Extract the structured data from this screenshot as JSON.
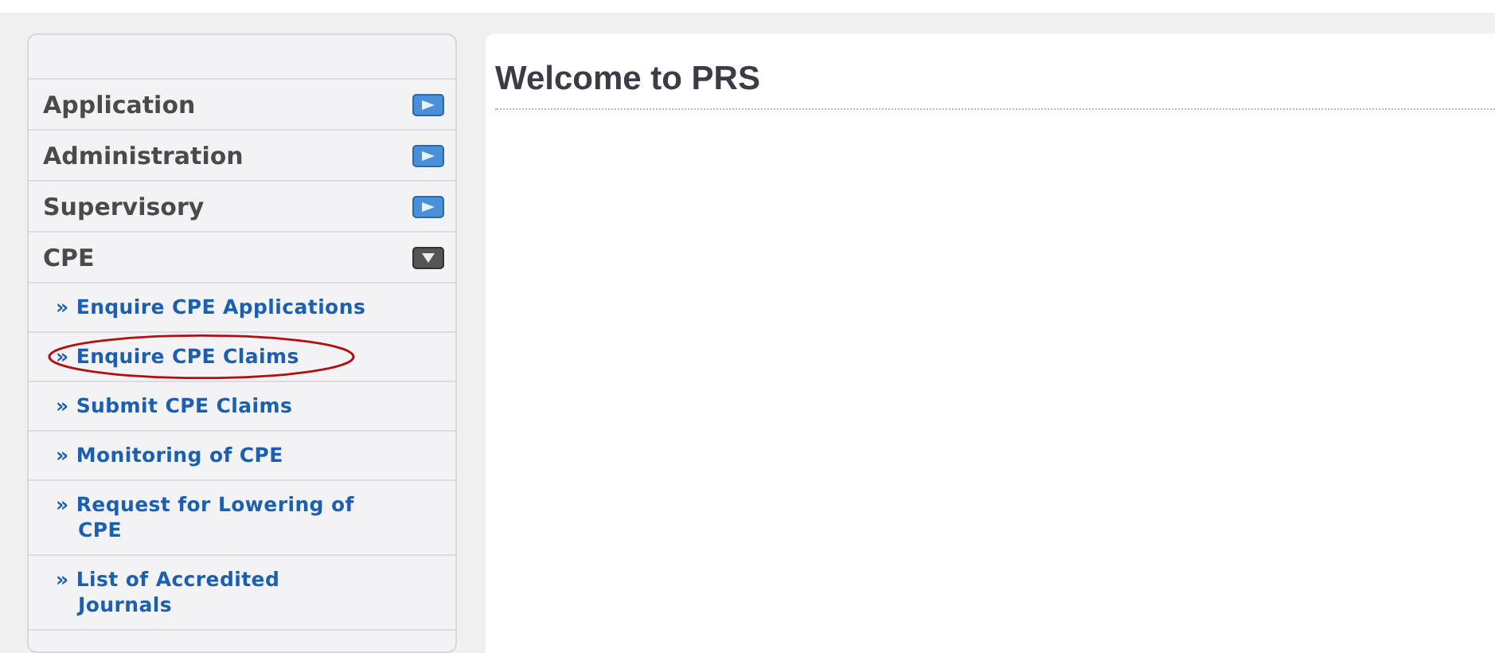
{
  "sidebar": {
    "menus": [
      {
        "label": "Application",
        "expanded": false
      },
      {
        "label": "Administration",
        "expanded": false
      },
      {
        "label": "Supervisory",
        "expanded": false
      },
      {
        "label": "CPE",
        "expanded": true,
        "items": [
          {
            "label": "» Enquire CPE Applications",
            "circled": false
          },
          {
            "label": "» Enquire CPE Claims",
            "circled": true
          },
          {
            "label": "» Submit CPE Claims",
            "circled": false
          },
          {
            "label": "» Monitoring of CPE",
            "circled": false
          },
          {
            "label": "» Request for Lowering of CPE",
            "circled": false
          },
          {
            "label": "» List of Accredited Journals",
            "circled": false
          }
        ]
      }
    ]
  },
  "main": {
    "title": "Welcome to PRS"
  }
}
